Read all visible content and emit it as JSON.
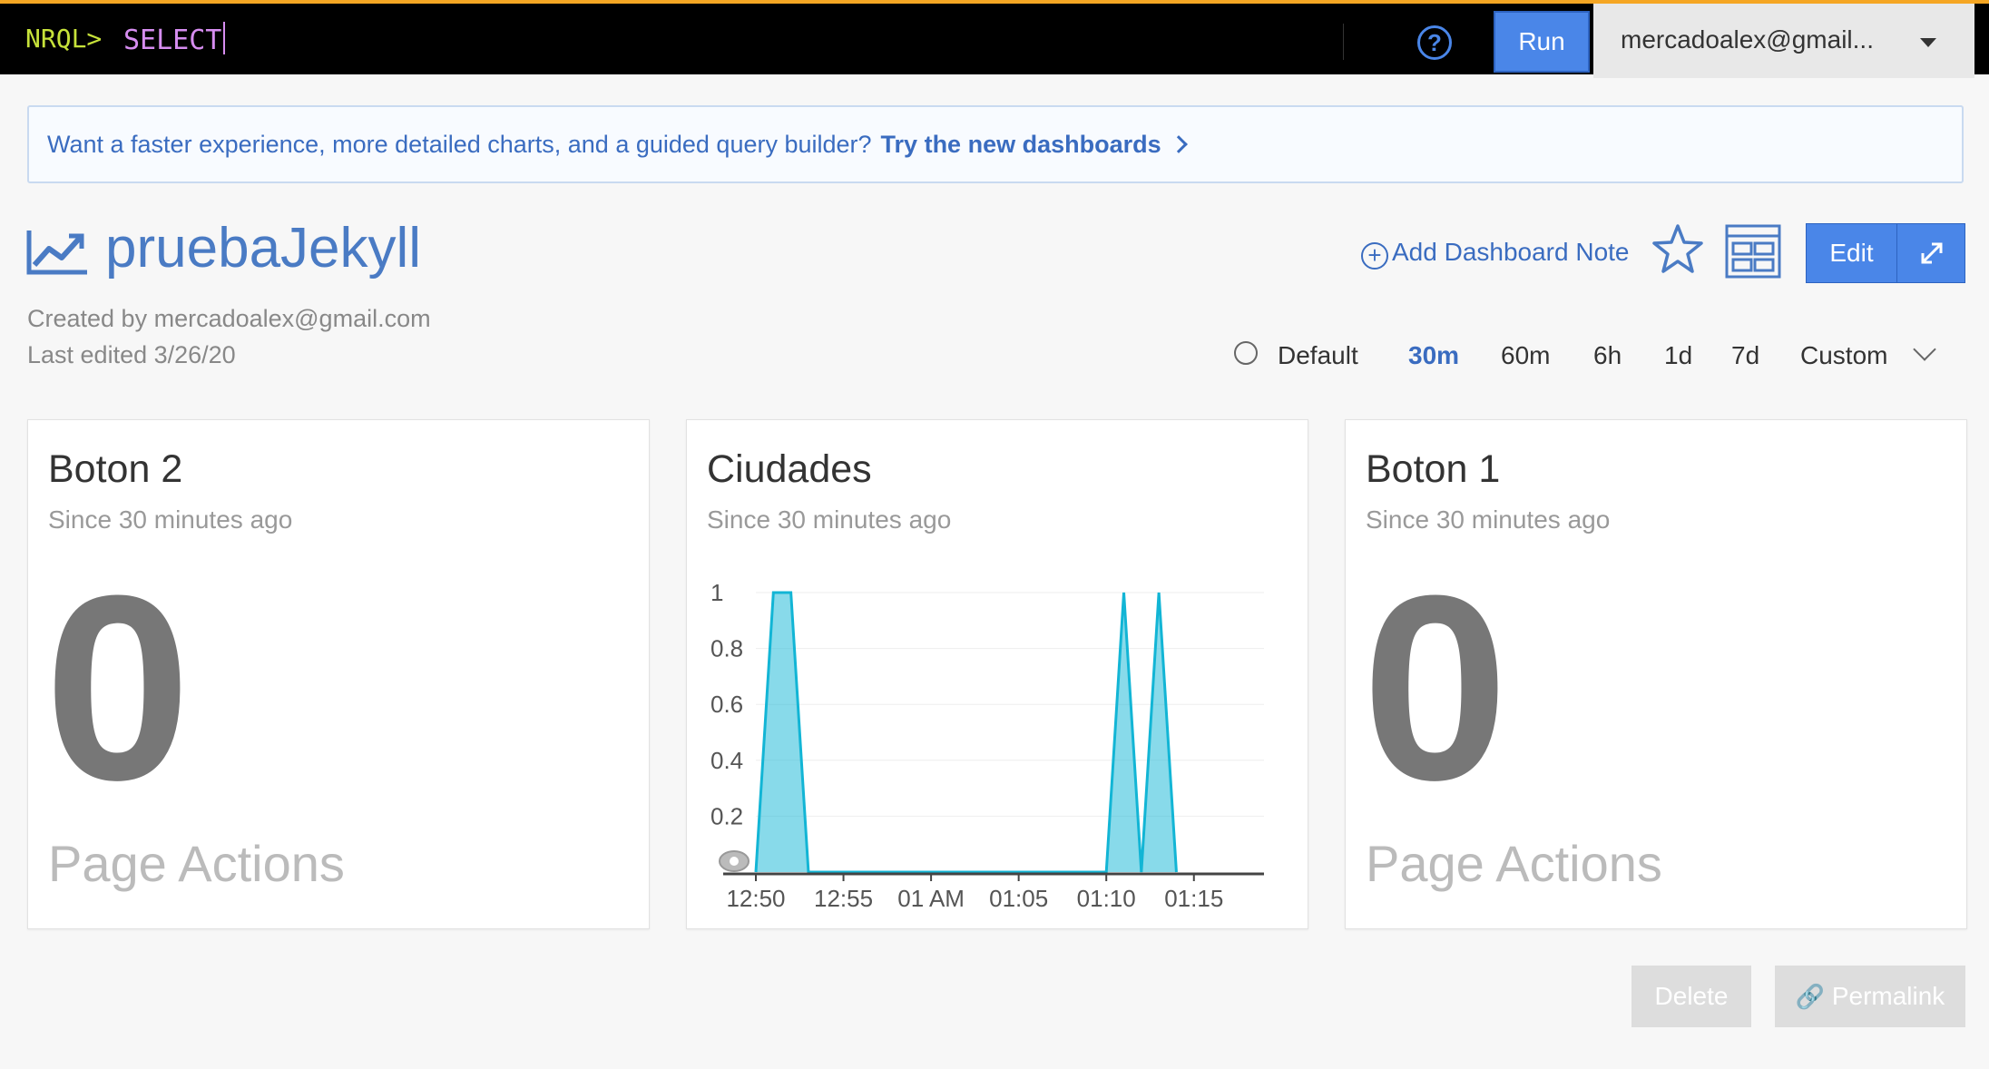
{
  "query_bar": {
    "prompt": "NRQL>",
    "query_text": "SELECT",
    "run_label": "Run",
    "account": "mercadoalex@gmail..."
  },
  "banner": {
    "text": "Want a faster experience, more detailed charts, and a guided query builder?",
    "link_text": "Try the new dashboards"
  },
  "dashboard": {
    "title": "pruebaJekyll",
    "created_by": "Created by mercadoalex@gmail.com",
    "last_edited": "Last edited 3/26/20",
    "add_note_label": "Add Dashboard Note",
    "edit_label": "Edit"
  },
  "time_range": {
    "options": [
      "Default",
      "30m",
      "60m",
      "6h",
      "1d",
      "7d",
      "Custom"
    ],
    "selected": "30m"
  },
  "widgets": [
    {
      "title": "Boton 2",
      "subtitle": "Since 30 minutes ago",
      "value": "0",
      "label": "Page Actions"
    },
    {
      "title": "Ciudades",
      "subtitle": "Since 30 minutes ago"
    },
    {
      "title": "Boton 1",
      "subtitle": "Since 30 minutes ago",
      "value": "0",
      "label": "Page Actions"
    }
  ],
  "chart_data": {
    "type": "area",
    "x_ticks": [
      "12:50",
      "12:55",
      "01 AM",
      "01:05",
      "01:10",
      "01:15"
    ],
    "y_ticks": [
      "1",
      "0.8",
      "0.6",
      "0.4",
      "0.2"
    ],
    "ylim": [
      0,
      1
    ],
    "x_minutes": [
      0,
      1,
      2,
      3,
      4,
      20,
      21,
      22,
      23,
      24
    ],
    "values": [
      0,
      1,
      1,
      0,
      0,
      0,
      1,
      0,
      1,
      0
    ],
    "color": "#12b5d5",
    "grid": true
  },
  "footer": {
    "delete_label": "Delete",
    "permalink_label": "Permalink"
  },
  "colors": {
    "accent": "#4a86e8",
    "link": "#3a6cc0",
    "top_border": "#f5a623"
  }
}
